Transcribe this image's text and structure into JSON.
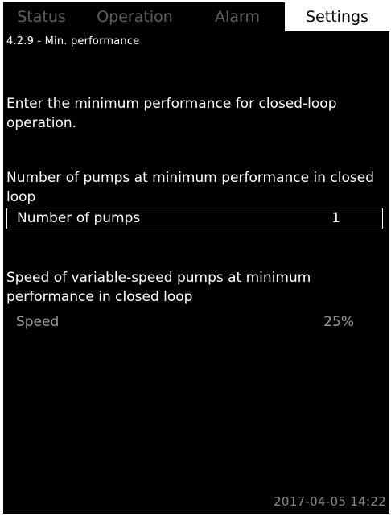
{
  "tabs": [
    {
      "label": "Status"
    },
    {
      "label": "Operation"
    },
    {
      "label": "Alarm"
    },
    {
      "label": "Settings",
      "active": true
    }
  ],
  "breadcrumb": "4.2.9 - Min. performance",
  "description": "Enter the minimum performance for closed-loop operation.",
  "pumps_section": {
    "heading": "Number of pumps at minimum performance in closed loop",
    "label": "Number of pumps",
    "value": "1"
  },
  "speed_section": {
    "heading": "Speed of variable-speed pumps at minimum performance in closed loop",
    "label": "Speed",
    "value": "25%"
  },
  "footer": {
    "datetime": "2017-04-05 14:22"
  },
  "colors": {
    "screen_bg": "#000000",
    "text": "#ffffff",
    "inactive_tab": "#5f5f5f",
    "dim_text": "#9a9a9a"
  }
}
